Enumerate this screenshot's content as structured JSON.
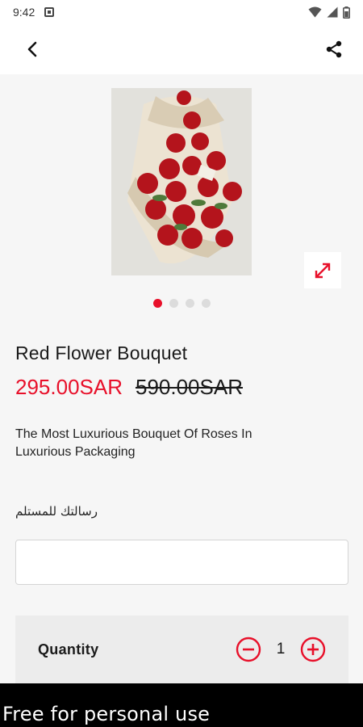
{
  "status_bar": {
    "time": "9:42"
  },
  "product": {
    "title": "Red Flower Bouquet",
    "price": "295.00SAR",
    "old_price": "590.00SAR",
    "description": "The Most Luxurious Bouquet Of Roses In Luxurious Packaging",
    "image_count": 4,
    "active_image_index": 0
  },
  "form": {
    "message_label": "رسالتك للمستلم",
    "message_value": "",
    "message_placeholder": ""
  },
  "quantity": {
    "label": "Quantity",
    "value": "1"
  },
  "watermark": "Free for personal use",
  "colors": {
    "accent": "#e8102a",
    "background": "#f6f6f6"
  },
  "icons": {
    "back": "back-arrow-icon",
    "share": "share-icon",
    "expand": "expand-icon",
    "minus": "minus-circle-icon",
    "plus": "plus-circle-icon"
  }
}
